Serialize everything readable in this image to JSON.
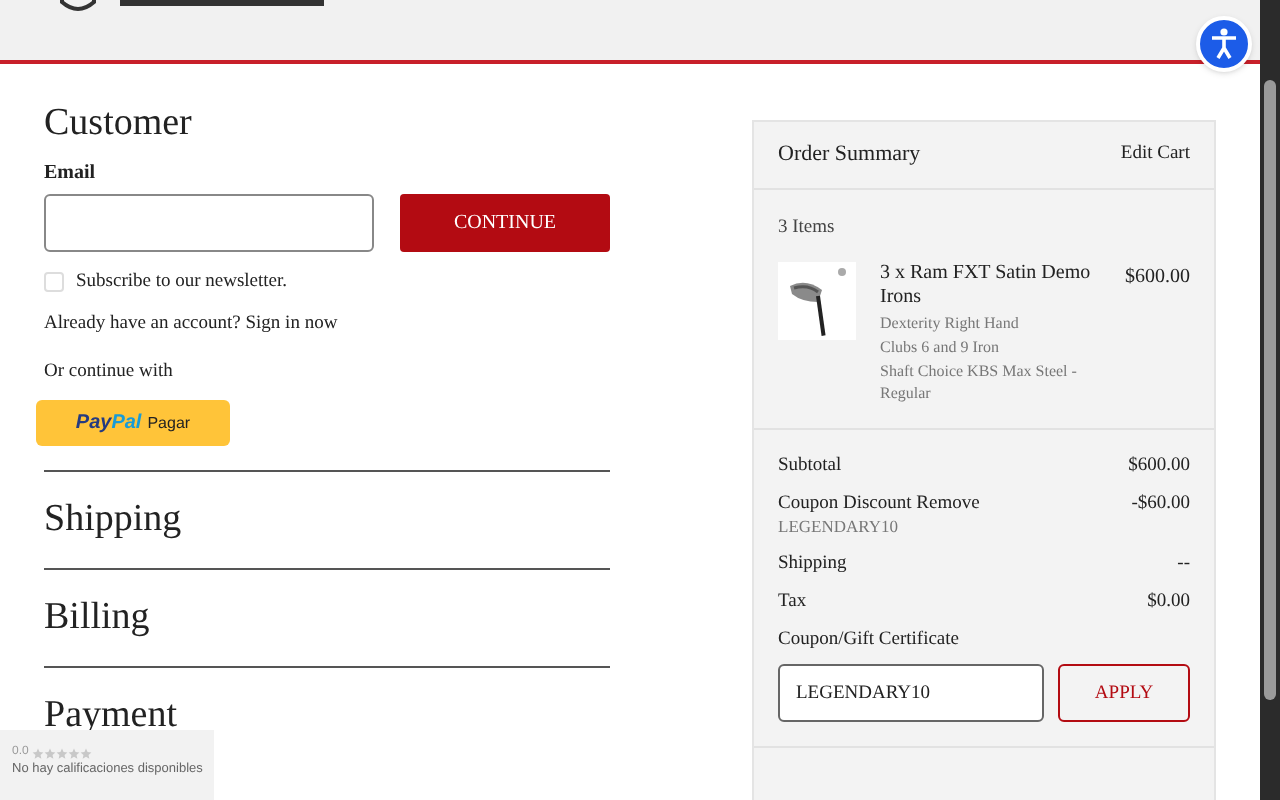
{
  "customer": {
    "title": "Customer",
    "email_label": "Email",
    "continue_button": "CONTINUE",
    "newsletter": {
      "label": "Subscribe to our newsletter.",
      "checked": false
    },
    "account_text": "Already have an account? Sign in now",
    "or_continue": "Or continue with",
    "paypal": {
      "brand_a": "Pay",
      "brand_b": "Pal",
      "label": "Pagar"
    }
  },
  "sections": [
    {
      "title": "Shipping"
    },
    {
      "title": "Billing"
    },
    {
      "title": "Payment"
    }
  ],
  "order_summary": {
    "title": "Order Summary",
    "edit_link": "Edit Cart",
    "count": "3 Items",
    "item": {
      "name": "3 x Ram FXT Satin Demo Irons",
      "price": "$600.00",
      "options": [
        "Dexterity Right Hand",
        "Clubs 6 and 9 Iron",
        "Shaft Choice KBS Max Steel - Regular"
      ]
    },
    "lines": [
      {
        "label": "Subtotal",
        "value": "$600.00"
      },
      {
        "label": "Coupon Discount Remove",
        "sub": "LEGENDARY10",
        "value": "-$60.00"
      },
      {
        "label": "Shipping",
        "value": "--"
      },
      {
        "label": "Tax",
        "value": "$0.00"
      }
    ],
    "coupon_label": "Coupon/Gift Certificate",
    "coupon_value": "LEGENDARY10",
    "apply_button": "APPLY"
  },
  "rating_widget": {
    "score": "0.0",
    "stars": 0,
    "text": "No hay calificaciones disponibles"
  }
}
